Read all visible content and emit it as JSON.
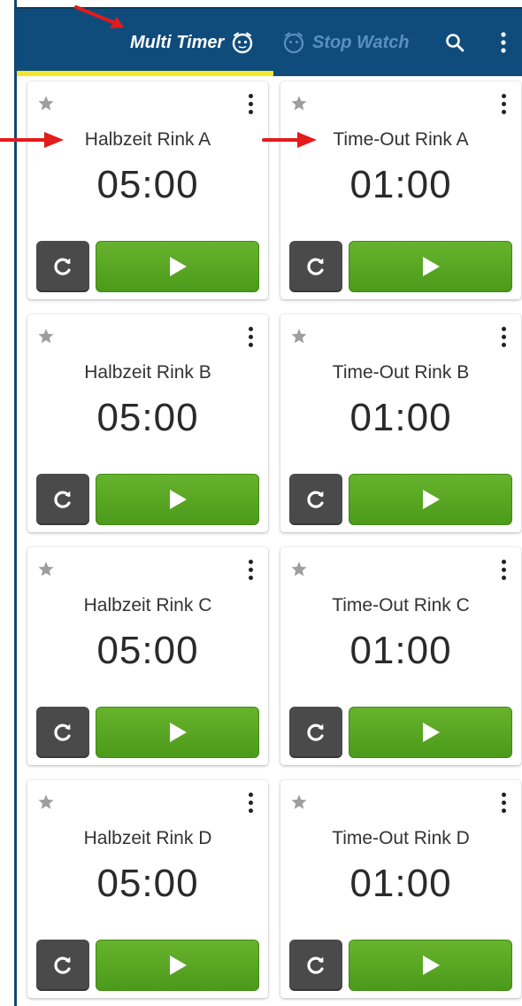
{
  "appbar": {
    "tabs": [
      {
        "label": "Multi Timer",
        "icon": "alarm-face-icon",
        "active": true
      },
      {
        "label": "Stop Watch",
        "icon": "alarm-clock-icon",
        "active": false
      }
    ],
    "actions": [
      {
        "icon": "search-icon"
      },
      {
        "icon": "more-vert-icon"
      }
    ],
    "colors": {
      "bar": "#0f4c7b",
      "indicator": "#f4e62e",
      "active_tab": "#ffffff",
      "inactive_tab": "#5a8fc4"
    }
  },
  "timers": [
    {
      "title": "Halbzeit Rink A",
      "time": "05:00"
    },
    {
      "title": "Time-Out Rink A",
      "time": "01:00"
    },
    {
      "title": "Halbzeit Rink B",
      "time": "05:00"
    },
    {
      "title": "Time-Out Rink B",
      "time": "01:00"
    },
    {
      "title": "Halbzeit Rink C",
      "time": "05:00"
    },
    {
      "title": "Time-Out Rink C",
      "time": "01:00"
    },
    {
      "title": "Halbzeit Rink D",
      "time": "05:00"
    },
    {
      "title": "Time-Out Rink D",
      "time": "01:00"
    }
  ],
  "card_icons": {
    "favorite": "star-icon",
    "menu": "more-vert-icon",
    "reset": "reset-icon",
    "start": "play-icon"
  },
  "colors": {
    "play": "#5aa824",
    "reset": "#4a4a4a",
    "annotation_arrow": "#e31b1b"
  }
}
